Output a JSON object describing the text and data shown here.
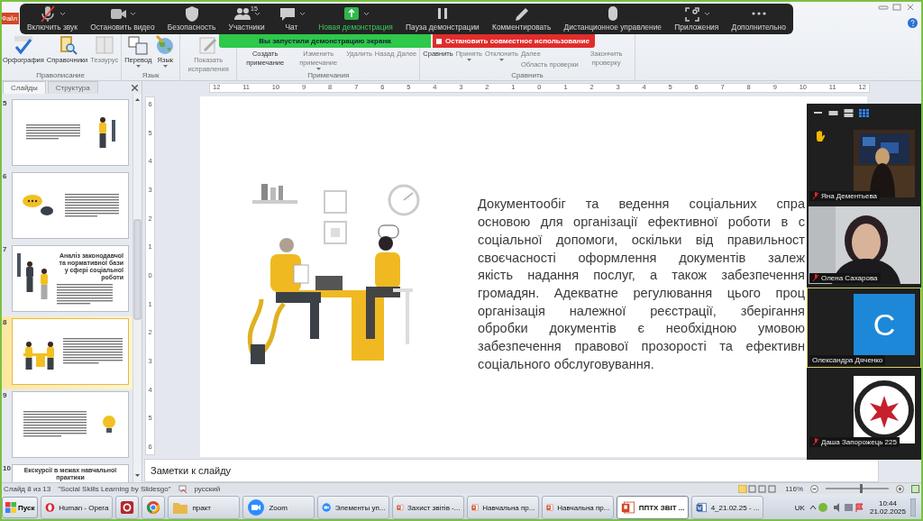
{
  "app_tab": "Файл",
  "zoom_toolbar": {
    "items": [
      {
        "label": "Включить звук",
        "kind": "mic",
        "menu": true
      },
      {
        "label": "Остановить видео",
        "kind": "video",
        "menu": true
      },
      {
        "label": "Безопасность",
        "kind": "shield",
        "menu": false
      },
      {
        "label": "Участники",
        "kind": "people",
        "menu": true,
        "count": "15"
      },
      {
        "label": "Чат",
        "kind": "chat",
        "menu": true
      },
      {
        "label": "Новая демонстрация",
        "kind": "share",
        "menu": true
      },
      {
        "label": "Пауза демонстрации",
        "kind": "pause",
        "menu": false
      },
      {
        "label": "Комментировать",
        "kind": "pen",
        "menu": false
      },
      {
        "label": "Дистанционное управление",
        "kind": "mouse",
        "menu": false
      },
      {
        "label": "Приложения",
        "kind": "apps",
        "menu": true
      },
      {
        "label": "Дополнительно",
        "kind": "more",
        "menu": false
      }
    ]
  },
  "share_banner": {
    "text": "Вы запустили демонстрацию экрана"
  },
  "stop_share": {
    "label": "Остановить совместное использование"
  },
  "ribbon": {
    "groups": [
      {
        "label": "Правописание",
        "buttons": [
          {
            "label": "Орфография",
            "kind": "spelling",
            "disabled": false,
            "menu": false
          },
          {
            "label": "Справочники",
            "kind": "book",
            "disabled": false,
            "menu": false
          },
          {
            "label": "Тезаурус",
            "kind": "thesaurus",
            "disabled": true,
            "menu": false
          }
        ]
      },
      {
        "label": "Язык",
        "buttons": [
          {
            "label": "Перевод",
            "kind": "translate",
            "disabled": false,
            "menu": true
          },
          {
            "label": "Язык",
            "kind": "language",
            "disabled": false,
            "menu": true
          }
        ]
      },
      {
        "buttons": [
          {
            "label": "Показать исправления",
            "kind": "markup",
            "disabled": true,
            "menu": false
          }
        ]
      },
      {
        "label": "Примечания",
        "buttons": [
          {
            "label": "Создать примечание",
            "kind": "plain",
            "disabled": false,
            "menu": false
          },
          {
            "label": "Изменить примечание",
            "kind": "plain",
            "disabled": true,
            "menu": true
          },
          {
            "label": "Удалить",
            "kind": "plain",
            "disabled": true,
            "menu": false
          },
          {
            "label": "Назад",
            "kind": "plain",
            "disabled": true,
            "menu": false
          },
          {
            "label": "Далее",
            "kind": "plain",
            "disabled": true,
            "menu": false
          }
        ]
      },
      {
        "label": "Сравнить",
        "buttons": [
          {
            "label": "Сравнить",
            "kind": "plain",
            "disabled": false,
            "menu": false
          },
          {
            "label": "Принять",
            "kind": "plain",
            "disabled": true,
            "menu": true
          },
          {
            "label": "Отклонить",
            "kind": "plain",
            "disabled": true,
            "menu": true
          },
          {
            "label": "Далее",
            "kind": "small",
            "disabled": true
          },
          {
            "label": "Область проверки",
            "kind": "small",
            "disabled": true
          },
          {
            "label": "Закончить проверку",
            "kind": "plain",
            "disabled": true,
            "menu": false
          }
        ]
      }
    ]
  },
  "panel_tabs": [
    {
      "label": "Слайды",
      "selected": true
    },
    {
      "label": "Структура",
      "selected": false
    }
  ],
  "slides": [
    {
      "number": "5",
      "kind": "figure",
      "selected": false
    },
    {
      "number": "6",
      "kind": "chat",
      "selected": false
    },
    {
      "number": "7",
      "kind": "people",
      "title": "Аналіз законодавчої та нормативної бази у сфері соціальної роботи",
      "selected": false
    },
    {
      "number": "8",
      "kind": "desk",
      "selected": true
    },
    {
      "number": "9",
      "kind": "bulb",
      "selected": false
    },
    {
      "number": "10",
      "kind": "title",
      "title": "Екскурсії в межах навчальної практики",
      "selected": false
    }
  ],
  "ruler_horizontal": [
    "12",
    "11",
    "10",
    "9",
    "8",
    "7",
    "6",
    "5",
    "4",
    "3",
    "2",
    "1",
    "0",
    "1",
    "2",
    "3",
    "4",
    "5",
    "6",
    "7",
    "8",
    "9",
    "10",
    "11",
    "12"
  ],
  "ruler_vertical": [
    "6",
    "5",
    "4",
    "3",
    "2",
    "1",
    "0",
    "1",
    "2",
    "3",
    "4",
    "5",
    "6"
  ],
  "slide": {
    "lines": [
      "Документообіг та ведення соціальних спра",
      "основою для організації ефективної роботи в с",
      "соціальної допомоги, оскільки від правильност",
      "своєчасності оформлення документів залеж",
      "якість надання послуг, а також забезпечення",
      "громадян. Адекватне регулювання цього проц",
      "організація належної реєстрації, зберігання",
      "обробки документів є необхідною умовою",
      "забезпечення правової прозорості та ефективн",
      "соціального обслуговування."
    ]
  },
  "notes": {
    "placeholder": "Заметки к слайду"
  },
  "video_panel": {
    "layouts": [
      {
        "selected": false
      },
      {
        "selected": false
      },
      {
        "selected": false
      },
      {
        "selected": true
      }
    ],
    "participants": [
      {
        "name": "Яна Дементьева",
        "muted": true,
        "hand_raised": true,
        "speaking": false
      },
      {
        "name": "Олена Сахарова",
        "kind": "video",
        "muted": true,
        "hand_raised": false,
        "speaking": false
      },
      {
        "name": "Олександра Дяченко",
        "kind": "initial",
        "initial": "C",
        "muted": false,
        "hand_raised": false,
        "speaking": true
      },
      {
        "name": "Даша Запорожець 225",
        "muted": true,
        "hand_raised": false,
        "speaking": false
      }
    ]
  },
  "status_bar": {
    "slide": "Слайд 8 из 13",
    "theme": "\"Social Skills Learning by Slidesgo\"",
    "language": "русский",
    "zoom": "116%",
    "zoom_slider": {
      "level": 0.55
    }
  },
  "taskbar": {
    "start": "Пуск",
    "items": [
      {
        "label": "Human - Opera",
        "kind": "opera",
        "selected": false
      },
      {
        "kind": "app",
        "selected": false
      },
      {
        "kind": "chrome",
        "selected": false
      },
      {
        "label": "практ",
        "kind": "folder",
        "selected": false
      },
      {
        "label": "Zoom",
        "kind": "zoom",
        "selected": false
      },
      {
        "label": "Элементы уп...",
        "kind": "zoom",
        "selected": false
      },
      {
        "label": "Захист звітів -...",
        "kind": "ppt",
        "selected": false
      },
      {
        "label": "Навчальна пр...",
        "kind": "ppt",
        "selected": false
      },
      {
        "label": "Навчальна пр...",
        "kind": "ppt",
        "selected": false
      },
      {
        "label": "ППТХ ЗВІТ ...",
        "kind": "ppt",
        "selected": true
      },
      {
        "label": "4_21.02.25 - ...",
        "kind": "word",
        "selected": false
      }
    ],
    "tray": {
      "language": "UK",
      "time": "10:44",
      "date": "21.02.2025"
    }
  }
}
